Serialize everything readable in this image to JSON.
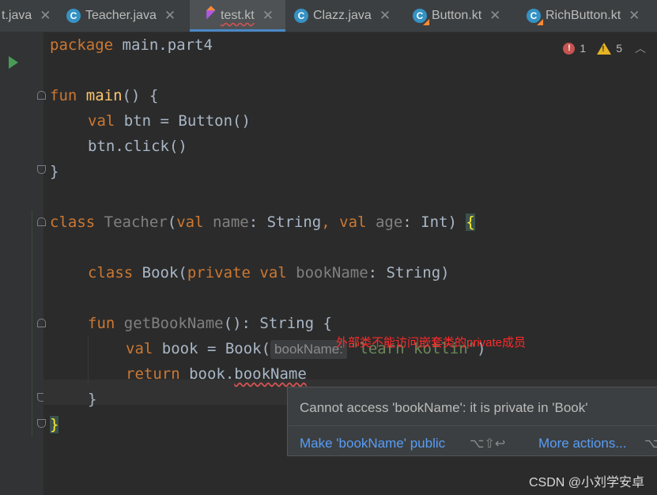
{
  "tabs": [
    {
      "label": "t.java",
      "icon": "java-class-icon",
      "active": false
    },
    {
      "label": "Teacher.java",
      "icon": "java-class-icon",
      "active": false
    },
    {
      "label": "test.kt",
      "icon": "kotlin-file-icon",
      "active": true
    },
    {
      "label": "Clazz.java",
      "icon": "java-class-icon",
      "active": false
    },
    {
      "label": "Button.kt",
      "icon": "kotlin-class-icon",
      "active": false
    },
    {
      "label": "RichButton.kt",
      "icon": "kotlin-class-icon",
      "active": false
    }
  ],
  "close_glyph": "✕",
  "class_letter": "C",
  "inspections": {
    "errors": "1",
    "warnings": "5"
  },
  "code": {
    "l1": {
      "kw": "package",
      "rest": " main.part4"
    },
    "l2": {
      "kw": "fun",
      "name": "main",
      "rest": "() {"
    },
    "l3": {
      "kw": "val",
      "rest": " btn = Button()"
    },
    "l4": {
      "text": "btn.click()"
    },
    "l5": {
      "text": "}"
    },
    "l6": {
      "kw": "class",
      "name": "Teacher",
      "p1": "(",
      "kw2": "val",
      "param1": "name",
      "t1": ": String",
      "comma": ",",
      "kw3": "val",
      "param2": "age",
      "t2": ": Int) ",
      "brace": "{"
    },
    "l7": {
      "kw": "class",
      "name": " Book(",
      "kw2": "private",
      "kw3": "val",
      "param": "bookName",
      "rest": ": String)"
    },
    "l8": {
      "kw": "fun",
      "name": "getBookName",
      "rest": "(): String {"
    },
    "l9": {
      "kw": "val",
      "rest": " book = Book(",
      "hint": "bookName:",
      "str": "\"learn kotlin\"",
      "close": ")"
    },
    "l10": {
      "kw": "return",
      "rest": " book.",
      "err": "bookName"
    },
    "l11": {
      "text": "}"
    },
    "l12": {
      "text": "}"
    }
  },
  "annotation": "外部类不能访问嵌套类的private成员",
  "popup": {
    "message": "Cannot access 'bookName': it is private in 'Book'",
    "action": "Make 'bookName' public",
    "action_shortcut": "⌥⇧↩",
    "more": "More actions...",
    "more_shortcut": "⌥"
  },
  "watermark": "CSDN @小刘学安卓",
  "colors": {
    "keyword": "#cc7832",
    "function": "#ffc66d",
    "string": "#6a8759",
    "error": "#d25252",
    "link": "#589df6"
  }
}
